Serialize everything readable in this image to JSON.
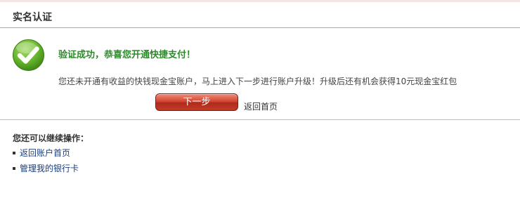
{
  "section": {
    "title": "实名认证"
  },
  "result": {
    "icon": "checkmark-success-icon",
    "icon_color": "#69b62d",
    "heading": "验证成功，恭喜您开通快捷支付！",
    "heading_color": "#2c8a2a",
    "message": "您还未开通有收益的快钱现金宝账户，马上进入下一步进行账户升级！升级后还有机会获得10元现金宝红包"
  },
  "actions": {
    "next_label": "下一步",
    "return_home_label": "返回首页",
    "button_color": "#c23b28"
  },
  "more_operations": {
    "label": "您还可以继续操作：",
    "items": [
      {
        "label": "返回账户首页"
      },
      {
        "label": "管理我的银行卡"
      }
    ]
  }
}
